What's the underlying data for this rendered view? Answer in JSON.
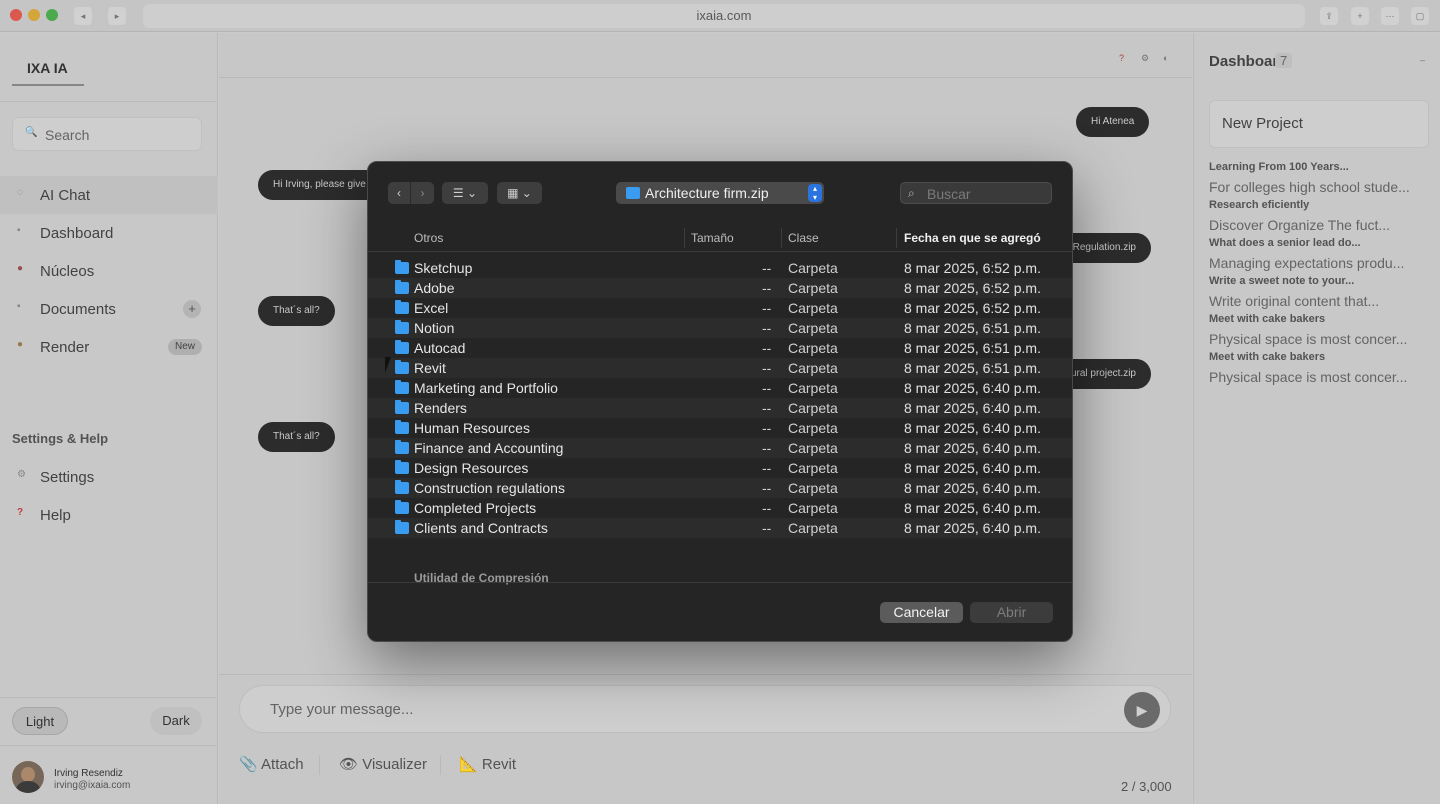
{
  "browser": {
    "url": "ixaia.com"
  },
  "sidebar": {
    "brand": "IXA IA",
    "search_placeholder": "Search",
    "items": [
      {
        "label": "AI Chat",
        "active": true
      },
      {
        "label": "Dashboard"
      },
      {
        "label": "Núcleos"
      },
      {
        "label": "Documents",
        "action": "+"
      },
      {
        "label": "Render",
        "badge": "New"
      }
    ],
    "settings_title": "Settings & Help",
    "settings_items": [
      {
        "label": "Settings"
      },
      {
        "label": "Help",
        "icon_text": "?"
      }
    ],
    "theme": {
      "light": "Light",
      "dark": "Dark"
    },
    "user": {
      "name": "Irving Resendiz",
      "email": "irving@ixaia.com"
    }
  },
  "chat": {
    "top_icons": [
      "?",
      "⚙",
      "◐"
    ],
    "messages": [
      {
        "text": "Hi Atenea"
      },
      {
        "text": "Hi Irving, please give me"
      },
      {
        "text": "▤ Regulation.zip"
      },
      {
        "text": "That´s all?"
      },
      {
        "text": "ctural project.zip"
      },
      {
        "text": "That´s all?"
      }
    ],
    "input_placeholder": "Type your message...",
    "tools": [
      "Attach",
      "Visualizer",
      "Revit"
    ],
    "counter": "2 / 3,000"
  },
  "dashboard": {
    "title": "Dashboard",
    "count": "7",
    "new_project": "New Project",
    "items": [
      {
        "head": "Learning From 100 Years...",
        "text": "For colleges high school stude..."
      },
      {
        "head": "Research eficiently",
        "text": "Discover Organize The fuct..."
      },
      {
        "head": "What does a senior lead do...",
        "text": "Managing expectations produ..."
      },
      {
        "head": "Write a sweet note to your...",
        "text": "Write original content that..."
      },
      {
        "head": "Meet with cake bakers",
        "text": "Physical space is most concer..."
      },
      {
        "head": "Meet with cake bakers",
        "text": "Physical space is most concer..."
      }
    ]
  },
  "dialog": {
    "path": "Architecture firm.zip",
    "search_placeholder": "Buscar",
    "columns": {
      "name": "Otros",
      "size": "Tamaño",
      "kind": "Clase",
      "date": "Fecha en que se agregó"
    },
    "rows": [
      {
        "name": "Sketchup",
        "size": "--",
        "kind": "Carpeta",
        "date": "8 mar 2025, 6:52 p.m."
      },
      {
        "name": "Adobe",
        "size": "--",
        "kind": "Carpeta",
        "date": "8 mar 2025, 6:52 p.m."
      },
      {
        "name": "Excel",
        "size": "--",
        "kind": "Carpeta",
        "date": "8 mar 2025, 6:52 p.m."
      },
      {
        "name": "Notion",
        "size": "--",
        "kind": "Carpeta",
        "date": "8 mar 2025, 6:51 p.m."
      },
      {
        "name": "Autocad",
        "size": "--",
        "kind": "Carpeta",
        "date": "8 mar 2025, 6:51 p.m."
      },
      {
        "name": "Revit",
        "size": "--",
        "kind": "Carpeta",
        "date": "8 mar 2025, 6:51 p.m."
      },
      {
        "name": "Marketing and Portfolio",
        "size": "--",
        "kind": "Carpeta",
        "date": "8 mar 2025, 6:40 p.m."
      },
      {
        "name": "Renders",
        "size": "--",
        "kind": "Carpeta",
        "date": "8 mar 2025, 6:40 p.m."
      },
      {
        "name": "Human Resources",
        "size": "--",
        "kind": "Carpeta",
        "date": "8 mar 2025, 6:40 p.m."
      },
      {
        "name": "Finance and Accounting",
        "size": "--",
        "kind": "Carpeta",
        "date": "8 mar 2025, 6:40 p.m."
      },
      {
        "name": "Design Resources",
        "size": "--",
        "kind": "Carpeta",
        "date": "8 mar 2025, 6:40 p.m."
      },
      {
        "name": "Construction regulations",
        "size": "--",
        "kind": "Carpeta",
        "date": "8 mar 2025, 6:40 p.m."
      },
      {
        "name": "Completed Projects",
        "size": "--",
        "kind": "Carpeta",
        "date": "8 mar 2025, 6:40 p.m."
      },
      {
        "name": "Clients and Contracts",
        "size": "--",
        "kind": "Carpeta",
        "date": "8 mar 2025, 6:40 p.m."
      }
    ],
    "group_label": "Utilidad de Compresión",
    "cancel": "Cancelar",
    "open": "Abrir"
  },
  "colors": {
    "folder": "#3a9cf0",
    "accent": "#2b74e0",
    "close": "#ff5f57",
    "minimize": "#febc2e",
    "zoom": "#28c840"
  }
}
